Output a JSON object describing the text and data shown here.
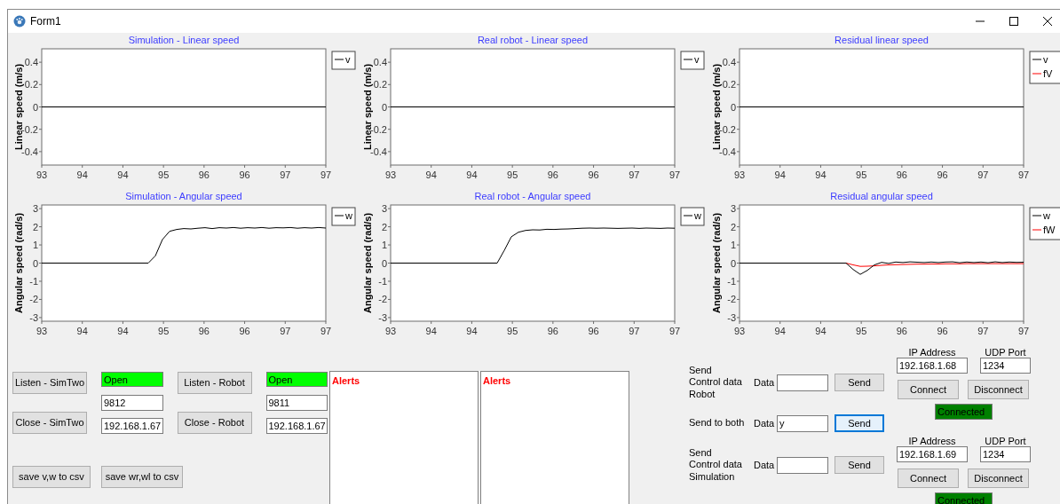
{
  "window": {
    "title": "Form1"
  },
  "charts": [
    {
      "chart_data": {
        "type": "line",
        "title": "Simulation - Linear speed",
        "ylabel": "Linear speed (m/s)",
        "legend": "right",
        "x": [
          93.2,
          97.4
        ],
        "series": [
          {
            "name": "v",
            "color": "#000000",
            "values": [
              0,
              0
            ]
          }
        ],
        "xlim": [
          93.2,
          97.4
        ],
        "ylim": [
          -0.52,
          0.52
        ],
        "xticks": [
          {
            "value": 93.2,
            "label": "93"
          },
          {
            "value": 93.8,
            "label": "94"
          },
          {
            "value": 94.4,
            "label": "94"
          },
          {
            "value": 95.0,
            "label": "95"
          },
          {
            "value": 95.6,
            "label": "96"
          },
          {
            "value": 96.2,
            "label": "96"
          },
          {
            "value": 96.8,
            "label": "97"
          },
          {
            "value": 97.4,
            "label": "97"
          }
        ],
        "yticks": [
          0.4,
          0.2,
          0,
          -0.2,
          -0.4
        ]
      }
    },
    {
      "chart_data": {
        "type": "line",
        "title": "Real robot - Linear speed",
        "ylabel": "Linear speed (m/s)",
        "legend": "right",
        "x": [
          93.2,
          97.4
        ],
        "series": [
          {
            "name": "v",
            "color": "#000000",
            "values": [
              0,
              0
            ]
          }
        ],
        "xlim": [
          93.2,
          97.4
        ],
        "ylim": [
          -0.52,
          0.52
        ],
        "xticks": [
          {
            "value": 93.2,
            "label": "93"
          },
          {
            "value": 93.8,
            "label": "94"
          },
          {
            "value": 94.4,
            "label": "94"
          },
          {
            "value": 95.0,
            "label": "95"
          },
          {
            "value": 95.6,
            "label": "96"
          },
          {
            "value": 96.2,
            "label": "96"
          },
          {
            "value": 96.8,
            "label": "97"
          },
          {
            "value": 97.4,
            "label": "97"
          }
        ],
        "yticks": [
          0.4,
          0.2,
          0,
          -0.2,
          -0.4
        ]
      }
    },
    {
      "chart_data": {
        "type": "line",
        "title": "Residual linear speed",
        "ylabel": "Linear speed (m/s)",
        "legend": "right",
        "x": [
          93.2,
          97.4
        ],
        "series": [
          {
            "name": "v",
            "color": "#000000",
            "values": [
              0,
              0
            ]
          },
          {
            "name": "fV",
            "color": "#ff0000",
            "values": [
              null,
              null
            ]
          }
        ],
        "xlim": [
          93.2,
          97.4
        ],
        "ylim": [
          -0.52,
          0.52
        ],
        "xticks": [
          {
            "value": 93.2,
            "label": "93"
          },
          {
            "value": 93.8,
            "label": "94"
          },
          {
            "value": 94.4,
            "label": "94"
          },
          {
            "value": 95.0,
            "label": "95"
          },
          {
            "value": 95.6,
            "label": "96"
          },
          {
            "value": 96.2,
            "label": "96"
          },
          {
            "value": 96.8,
            "label": "97"
          },
          {
            "value": 97.4,
            "label": "97"
          }
        ],
        "yticks": [
          0.4,
          0.2,
          0,
          -0.2,
          -0.4
        ]
      }
    },
    {
      "chart_data": {
        "type": "line",
        "title": "Simulation - Angular speed",
        "ylabel": "Angular speed (rad/s)",
        "legend": "right",
        "x": [
          93.2,
          93.305,
          93.41,
          93.515,
          93.62,
          93.725,
          93.83,
          93.935,
          94.04,
          94.145,
          94.25,
          94.355,
          94.46,
          94.565,
          94.67,
          94.775,
          94.88,
          94.985,
          95.09,
          95.195,
          95.3,
          95.405,
          95.51,
          95.615,
          95.72,
          95.825,
          95.93,
          96.035,
          96.14,
          96.245,
          96.35,
          96.455,
          96.56,
          96.665,
          96.77,
          96.875,
          96.98,
          97.085,
          97.19,
          97.295,
          97.4
        ],
        "series": [
          {
            "name": "w",
            "color": "#000000",
            "values": [
              0,
              0,
              0,
              0,
              0,
              0,
              0,
              0,
              0,
              0,
              0,
              0,
              0,
              0,
              0,
              0,
              0.4,
              1.3,
              1.75,
              1.85,
              1.9,
              1.88,
              1.92,
              1.95,
              1.9,
              1.95,
              1.93,
              1.96,
              1.92,
              1.95,
              1.93,
              1.96,
              1.92,
              1.95,
              1.94,
              1.96,
              1.92,
              1.95,
              1.93,
              1.96,
              1.93
            ]
          }
        ],
        "xlim": [
          93.2,
          97.4
        ],
        "ylim": [
          -3.2,
          3.2
        ],
        "xticks": [
          {
            "value": 93.2,
            "label": "93"
          },
          {
            "value": 93.8,
            "label": "94"
          },
          {
            "value": 94.4,
            "label": "94"
          },
          {
            "value": 95.0,
            "label": "95"
          },
          {
            "value": 95.6,
            "label": "96"
          },
          {
            "value": 96.2,
            "label": "96"
          },
          {
            "value": 96.8,
            "label": "97"
          },
          {
            "value": 97.4,
            "label": "97"
          }
        ],
        "yticks": [
          3,
          2,
          1,
          0,
          -1,
          -2,
          -3
        ]
      }
    },
    {
      "chart_data": {
        "type": "line",
        "title": "Real robot - Angular speed",
        "ylabel": "Angular speed (rad/s)",
        "legend": "right",
        "x": [
          93.2,
          93.305,
          93.41,
          93.515,
          93.62,
          93.725,
          93.83,
          93.935,
          94.04,
          94.145,
          94.25,
          94.355,
          94.46,
          94.565,
          94.67,
          94.775,
          94.88,
          94.985,
          95.09,
          95.195,
          95.3,
          95.405,
          95.51,
          95.615,
          95.72,
          95.825,
          95.93,
          96.035,
          96.14,
          96.245,
          96.35,
          96.455,
          96.56,
          96.665,
          96.77,
          96.875,
          96.98,
          97.085,
          97.19,
          97.295,
          97.4
        ],
        "series": [
          {
            "name": "w",
            "color": "#000000",
            "values": [
              0,
              0,
              0,
              0,
              0,
              0,
              0,
              0,
              0,
              0,
              0,
              0,
              0,
              0,
              0,
              0,
              0.7,
              1.45,
              1.7,
              1.8,
              1.83,
              1.82,
              1.86,
              1.85,
              1.87,
              1.88,
              1.9,
              1.92,
              1.93,
              1.92,
              1.93,
              1.92,
              1.91,
              1.92,
              1.93,
              1.91,
              1.93,
              1.92,
              1.91,
              1.93,
              1.92
            ]
          }
        ],
        "xlim": [
          93.2,
          97.4
        ],
        "ylim": [
          -3.2,
          3.2
        ],
        "xticks": [
          {
            "value": 93.2,
            "label": "93"
          },
          {
            "value": 93.8,
            "label": "94"
          },
          {
            "value": 94.4,
            "label": "94"
          },
          {
            "value": 95.0,
            "label": "95"
          },
          {
            "value": 95.6,
            "label": "96"
          },
          {
            "value": 96.2,
            "label": "96"
          },
          {
            "value": 96.8,
            "label": "97"
          },
          {
            "value": 97.4,
            "label": "97"
          }
        ],
        "yticks": [
          3,
          2,
          1,
          0,
          -1,
          -2,
          -3
        ]
      }
    },
    {
      "chart_data": {
        "type": "line",
        "title": "Residual angular speed",
        "ylabel": "Angular speed (rad/s)",
        "legend": "right",
        "x": [
          93.2,
          93.305,
          93.41,
          93.515,
          93.62,
          93.725,
          93.83,
          93.935,
          94.04,
          94.145,
          94.25,
          94.355,
          94.46,
          94.565,
          94.67,
          94.775,
          94.88,
          94.985,
          95.09,
          95.195,
          95.3,
          95.405,
          95.51,
          95.615,
          95.72,
          95.825,
          95.93,
          96.035,
          96.14,
          96.245,
          96.35,
          96.455,
          96.56,
          96.665,
          96.77,
          96.875,
          96.98,
          97.085,
          97.19,
          97.295,
          97.4
        ],
        "series": [
          {
            "name": "w",
            "color": "#000000",
            "values": [
              0,
              0,
              0,
              0,
              0,
              0,
              0,
              0,
              0,
              0,
              0,
              0,
              0,
              0,
              0,
              0,
              -0.35,
              -0.62,
              -0.4,
              -0.1,
              0.04,
              -0.02,
              0.06,
              0.03,
              0.07,
              0.05,
              0.03,
              0.06,
              0.03,
              0.06,
              0.07,
              0.02,
              0.06,
              0.03,
              0.06,
              0.02,
              0.07,
              0.03,
              0.06,
              0.04,
              0.05
            ]
          },
          {
            "name": "fW",
            "color": "#ff0000",
            "values": [
              null,
              null,
              null,
              null,
              null,
              null,
              null,
              null,
              null,
              null,
              null,
              null,
              null,
              null,
              null,
              0,
              -0.1,
              -0.18,
              -0.17,
              -0.15,
              -0.12,
              -0.1,
              -0.09,
              -0.08,
              -0.07,
              -0.06,
              -0.06,
              -0.05,
              -0.05,
              -0.04,
              -0.04,
              -0.04,
              -0.03,
              -0.03,
              -0.03,
              -0.03,
              -0.03,
              -0.03,
              -0.03,
              -0.03,
              -0.03
            ]
          }
        ],
        "xlim": [
          93.2,
          97.4
        ],
        "ylim": [
          -3.2,
          3.2
        ],
        "xticks": [
          {
            "value": 93.2,
            "label": "93"
          },
          {
            "value": 93.8,
            "label": "94"
          },
          {
            "value": 94.4,
            "label": "94"
          },
          {
            "value": 95.0,
            "label": "95"
          },
          {
            "value": 95.6,
            "label": "96"
          },
          {
            "value": 96.2,
            "label": "96"
          },
          {
            "value": 96.8,
            "label": "97"
          },
          {
            "value": 97.4,
            "label": "97"
          }
        ],
        "yticks": [
          3,
          2,
          1,
          0,
          -1,
          -2,
          -3
        ]
      }
    }
  ],
  "connection_panels": [
    {
      "listen_button": "Listen - SimTwo",
      "close_button": "Close - SimTwo",
      "status": "Open",
      "port": "9812",
      "ip": "192.168.1.67"
    },
    {
      "listen_button": "Listen - Robot",
      "close_button": "Close - Robot",
      "status": "Open",
      "port": "9811",
      "ip": "192.168.1.67"
    }
  ],
  "save_buttons": [
    "save v,w to csv",
    "save wr,wl to csv"
  ],
  "alert_boxes": [
    {
      "title": "Alerts"
    },
    {
      "title": "Alerts"
    }
  ],
  "send_rows": [
    {
      "label": "Send\nControl data\nRobot",
      "data_label": "Data",
      "button": "Send",
      "focused": false
    },
    {
      "label": "Send to both",
      "data_label": "Data",
      "value": "y",
      "button": "Send",
      "focused": true
    },
    {
      "label": "Send\nControl data\nSimulation",
      "data_label": "Data",
      "button": "Send",
      "focused": false
    }
  ],
  "udp_links": [
    {
      "ip_label": "IP Address",
      "port_label": "UDP Port",
      "ip": "192.168.1.68",
      "port": "1234",
      "connect_button": "Connect",
      "disconnect_button": "Disconnect",
      "status": "Connected"
    },
    {
      "ip_label": "IP Address",
      "port_label": "UDP Port",
      "ip": "192.168.1.69",
      "port": "1234",
      "connect_button": "Connect",
      "disconnect_button": "Disconnect",
      "status": "Connected"
    }
  ]
}
